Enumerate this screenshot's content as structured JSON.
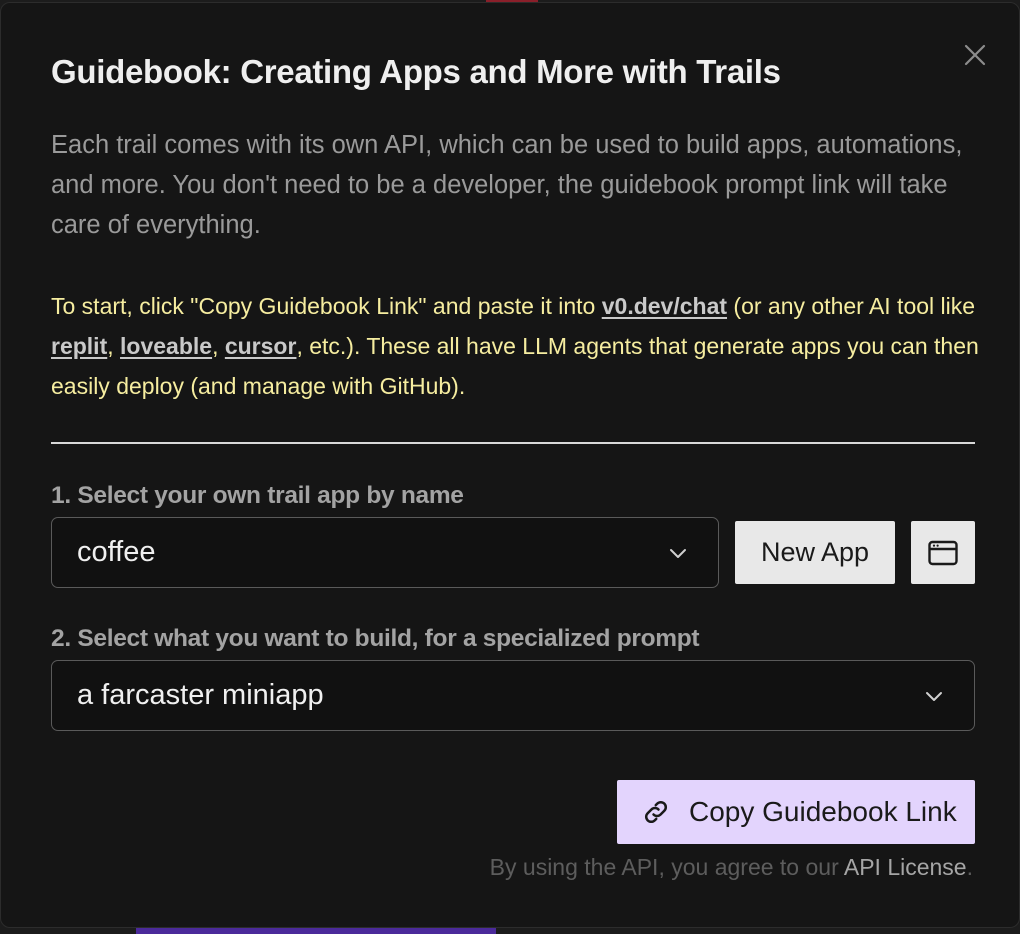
{
  "modal": {
    "title": "Guidebook: Creating Apps and More with Trails",
    "description": "Each trail comes with its own API, which can be used to build apps, automations, and more. You don't need to be a developer, the guidebook prompt link will take care of everything.",
    "instructions": {
      "part1": "To start, click \"Copy Guidebook Link\" and paste it into ",
      "link_v0": "v0.dev/chat",
      "part2": " (or any other AI tool like ",
      "link_replit": "replit",
      "sep1": ", ",
      "link_loveable": "loveable",
      "sep2": ", ",
      "link_cursor": "cursor",
      "part3": ", etc.). These all have LLM agents that generate apps you can then easily deploy (and manage with GitHub)."
    },
    "step1": {
      "label": "1. Select your own trail app by name",
      "selected": "coffee",
      "new_app_label": "New App"
    },
    "step2": {
      "label": "2. Select what you want to build, for a specialized prompt",
      "selected": "a farcaster miniapp"
    },
    "copy_button_label": "Copy Guidebook Link",
    "license": {
      "prefix": "By using the API, you agree to our ",
      "link": "API License",
      "suffix": "."
    }
  },
  "icons": {
    "close": "close-icon",
    "chevron": "chevron-down-icon",
    "browser": "browser-window-icon",
    "link": "link-icon"
  },
  "colors": {
    "background": "#151515",
    "highlight_text": "#f6eda0",
    "copy_button": "#e3d4fd"
  }
}
